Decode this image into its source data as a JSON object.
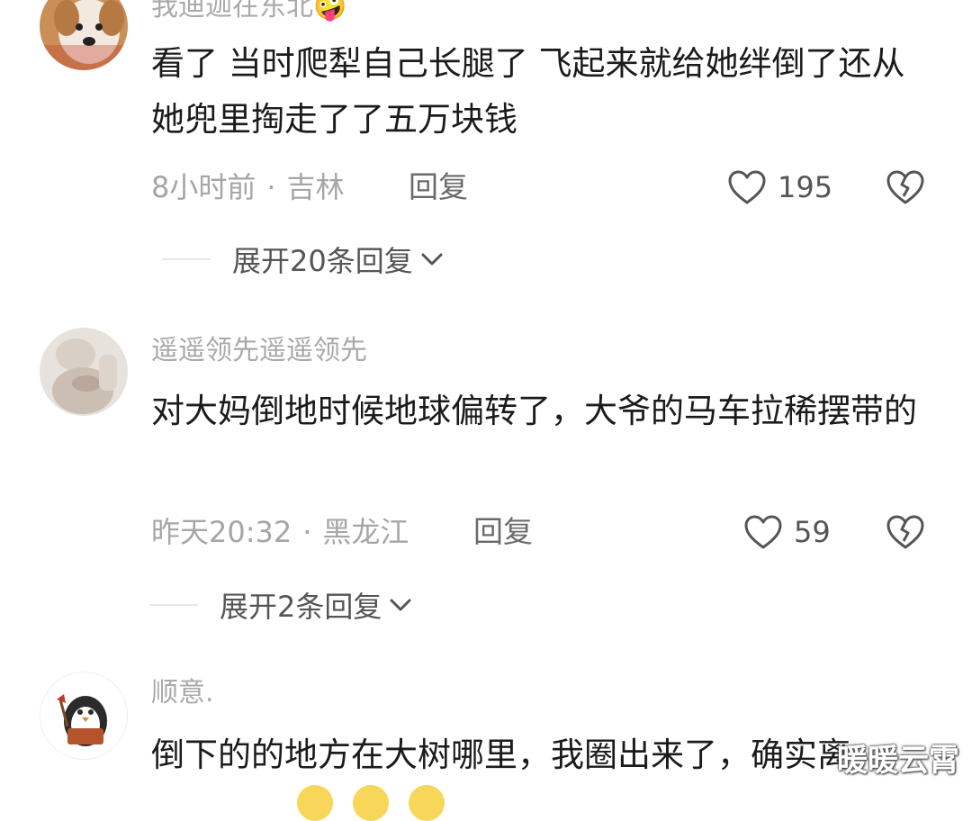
{
  "comments": [
    {
      "username": "我迪迦在东北🤪",
      "content": "看了 当时爬犁自己长腿了 飞起来就给她绊倒了还从她兜里掏走了了五万块钱",
      "time": "8小时前",
      "dot": "·",
      "location": "吉林",
      "reply_label": "回复",
      "likes": "195",
      "expand_label": "展开20条回复"
    },
    {
      "username": "遥遥领先遥遥领先",
      "content": "对大妈倒地时候地球偏转了，大爷的马车拉稀摆带的",
      "time": "昨天20:32",
      "dot": "·",
      "location": "黑龙江",
      "reply_label": "回复",
      "likes": "59",
      "expand_label": "展开2条回复"
    },
    {
      "username": "顺意.",
      "content": "倒下的的地方在大树哪里，我圈出来了，确实离"
    }
  ],
  "icons": {
    "like": "heart-outline-icon",
    "dislike": "broken-heart-icon",
    "expand": "chevron-down-icon"
  },
  "watermark": "暖暖云霄",
  "colors": {
    "text": "#1b1b1b",
    "meta": "#a6a6a6",
    "icon": "#555555"
  }
}
